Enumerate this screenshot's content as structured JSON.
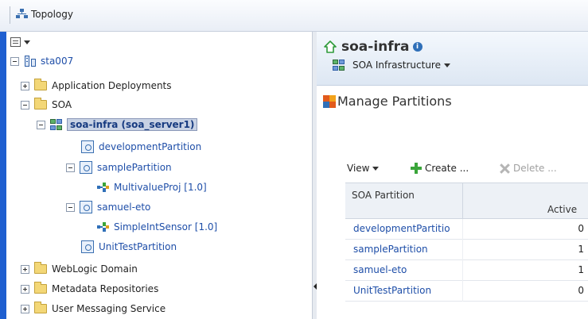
{
  "toolbar": {
    "topology_label": "Topology"
  },
  "tree": {
    "root": "sta007",
    "application_deployments": "Application Deployments",
    "soa": "SOA",
    "soa_infra": "soa-infra (soa_server1)",
    "development_partition": "developmentPartition",
    "sample_partition": "samplePartition",
    "multivalue_proj": "MultivalueProj [1.0]",
    "samuel_eto": "samuel-eto",
    "simple_int_sensor": "SimpleIntSensor [1.0]",
    "unit_test_partition": "UnitTestPartition",
    "weblogic_domain": "WebLogic Domain",
    "metadata_repositories": "Metadata Repositories",
    "user_messaging_service": "User Messaging Service"
  },
  "target": {
    "title": "soa-infra",
    "info_glyph": "i",
    "menu_label": "SOA Infrastructure"
  },
  "section": {
    "title": "Manage Partitions"
  },
  "table_toolbar": {
    "view": "View",
    "create": "Create ...",
    "delete": "Delete ..."
  },
  "table": {
    "columns": {
      "name": "SOA Partition",
      "active": "Active"
    },
    "rows": [
      {
        "name": "developmentPartitio",
        "active": "0"
      },
      {
        "name": "samplePartition",
        "active": "1"
      },
      {
        "name": "samuel-eto",
        "active": "1"
      },
      {
        "name": "UnitTestPartition",
        "active": "0"
      }
    ]
  },
  "colors": {
    "accent": "#1f5fd0",
    "link": "#1e4ea8",
    "selection": "#c8d2e4",
    "create": "#3aa53a"
  }
}
